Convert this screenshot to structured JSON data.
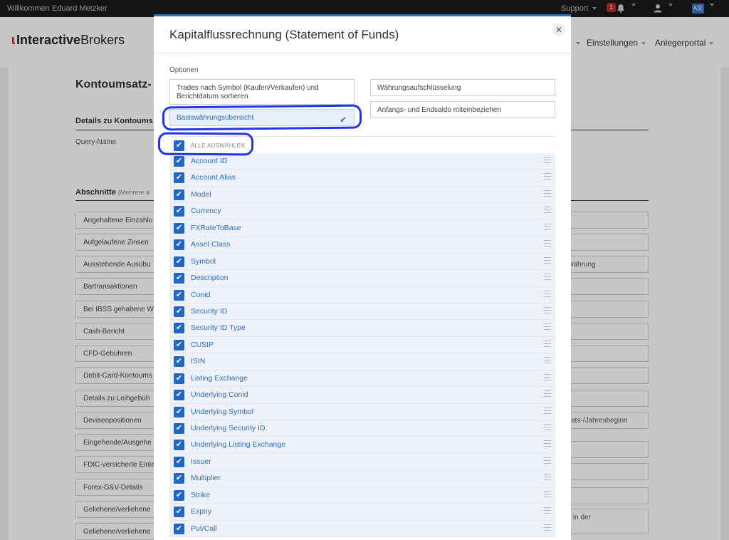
{
  "topbar": {
    "welcome": "Willkommen Eduard Metzker",
    "support": "Support",
    "notification_count": "1",
    "language_label": "A文",
    "icons": [
      "bell-icon",
      "user-icon",
      "language-icon"
    ]
  },
  "header": {
    "logo": {
      "prefix": "Interactive",
      "suffix": "Brokers"
    },
    "nav": {
      "settings": "Einstellungen",
      "portal": "Anlegerportal"
    }
  },
  "background": {
    "title": "Kontoumsatz-",
    "details_heading": "Details zu Kontoums",
    "query_name": "Query-Name",
    "sections_heading": "Abschnitte",
    "sections_hint": "(Mehrere a",
    "sections": [
      "Angehaltene Einzahlu",
      "Aufgelaufene Zinsen",
      "Ausstehende Ausübu",
      "Bartransaktionen",
      "Bei IBSS gehaltene W",
      "Cash-Bericht",
      "CFD-Gebühren",
      "Debit-Card-Kontoums",
      "Details zu Leihgebüh",
      "Devisenpositionen",
      "Eingehende/Ausgehe",
      "FDIC-versicherte Einla",
      "Forex-G&V-Details",
      "Geliehene/verliehene",
      "Geliehene/verliehene"
    ],
    "right_texts": {
      "currency": "iswährung",
      "month": "onats-/Jahresbeginn",
      "in_der": "ng in der"
    }
  },
  "modal": {
    "title": "Kapitalflussrechnung (Statement of Funds)",
    "options_label": "Optionen",
    "options": {
      "sort_trades": "Trades nach Symbol (Kaufen/Verkaufen) und Berichtdatum sortieren",
      "base_currency_summary": "Basiswährungsübersicht",
      "currency_breakdown": "Währungsaufschlüsselung",
      "opening_closing": "Anfangs- und Endsaldo miteinbeziehen"
    },
    "select_all": "ALLE AUSWÄHLEN",
    "fields": [
      "Account ID",
      "Account Alias",
      "Model",
      "Currency",
      "FXRateToBase",
      "Asset Class",
      "Symbol",
      "Description",
      "Conid",
      "Security ID",
      "Security ID Type",
      "CUSIP",
      "ISIN",
      "Listing Exchange",
      "Underlying Conid",
      "Underlying Symbol",
      "Underlying Security ID",
      "Underlying Listing Exchange",
      "Issuer",
      "Multiplier",
      "Strike",
      "Expiry",
      "Put/Call"
    ]
  },
  "colors": {
    "accent": "#2465c0",
    "link": "#2f6db8",
    "highlight_ink": "#1f35e8",
    "brand_red": "#d81e05"
  }
}
